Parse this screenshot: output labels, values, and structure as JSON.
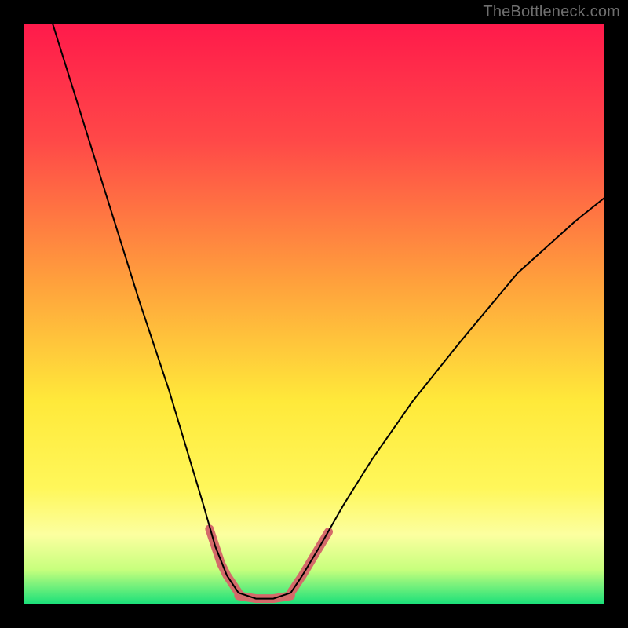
{
  "watermark": "TheBottleneck.com",
  "chart_data": {
    "type": "line",
    "title": "",
    "xlabel": "",
    "ylabel": "",
    "xlim": [
      0,
      100
    ],
    "ylim": [
      0,
      100
    ],
    "grid": false,
    "legend": false,
    "gradient_stops": [
      {
        "offset": 0.0,
        "color": "#ff1a4b"
      },
      {
        "offset": 0.2,
        "color": "#ff4848"
      },
      {
        "offset": 0.45,
        "color": "#ffa23c"
      },
      {
        "offset": 0.65,
        "color": "#ffe93a"
      },
      {
        "offset": 0.8,
        "color": "#fff75a"
      },
      {
        "offset": 0.88,
        "color": "#fcffa0"
      },
      {
        "offset": 0.94,
        "color": "#c7ff7d"
      },
      {
        "offset": 1.0,
        "color": "#18e07a"
      }
    ],
    "series": [
      {
        "name": "curve",
        "stroke": "#000000",
        "stroke_width": 2,
        "points": [
          {
            "x": 5,
            "y": 100
          },
          {
            "x": 10,
            "y": 84
          },
          {
            "x": 15,
            "y": 68
          },
          {
            "x": 20,
            "y": 52
          },
          {
            "x": 25,
            "y": 37
          },
          {
            "x": 28,
            "y": 27
          },
          {
            "x": 31,
            "y": 17
          },
          {
            "x": 33,
            "y": 10
          },
          {
            "x": 35,
            "y": 5
          },
          {
            "x": 37,
            "y": 2
          },
          {
            "x": 40,
            "y": 1
          },
          {
            "x": 43,
            "y": 1
          },
          {
            "x": 46,
            "y": 2
          },
          {
            "x": 48,
            "y": 5
          },
          {
            "x": 51,
            "y": 10
          },
          {
            "x": 55,
            "y": 17
          },
          {
            "x": 60,
            "y": 25
          },
          {
            "x": 67,
            "y": 35
          },
          {
            "x": 75,
            "y": 45
          },
          {
            "x": 85,
            "y": 57
          },
          {
            "x": 95,
            "y": 66
          },
          {
            "x": 100,
            "y": 70
          }
        ]
      },
      {
        "name": "highlight-left",
        "stroke": "#d46a6a",
        "stroke_width": 11,
        "linecap": "round",
        "points": [
          {
            "x": 32,
            "y": 13
          },
          {
            "x": 33,
            "y": 10
          },
          {
            "x": 34,
            "y": 7
          },
          {
            "x": 35,
            "y": 5
          },
          {
            "x": 36,
            "y": 3.5
          },
          {
            "x": 37,
            "y": 2
          }
        ]
      },
      {
        "name": "highlight-bottom",
        "stroke": "#d46a6a",
        "stroke_width": 11,
        "linecap": "round",
        "points": [
          {
            "x": 37,
            "y": 1.5
          },
          {
            "x": 40,
            "y": 1
          },
          {
            "x": 43,
            "y": 1
          },
          {
            "x": 46,
            "y": 1.5
          }
        ]
      },
      {
        "name": "highlight-right",
        "stroke": "#d46a6a",
        "stroke_width": 11,
        "linecap": "round",
        "points": [
          {
            "x": 46,
            "y": 2
          },
          {
            "x": 47,
            "y": 3.5
          },
          {
            "x": 48,
            "y": 5
          },
          {
            "x": 49.5,
            "y": 7.5
          },
          {
            "x": 51,
            "y": 10
          },
          {
            "x": 52.5,
            "y": 12.5
          }
        ]
      }
    ]
  }
}
